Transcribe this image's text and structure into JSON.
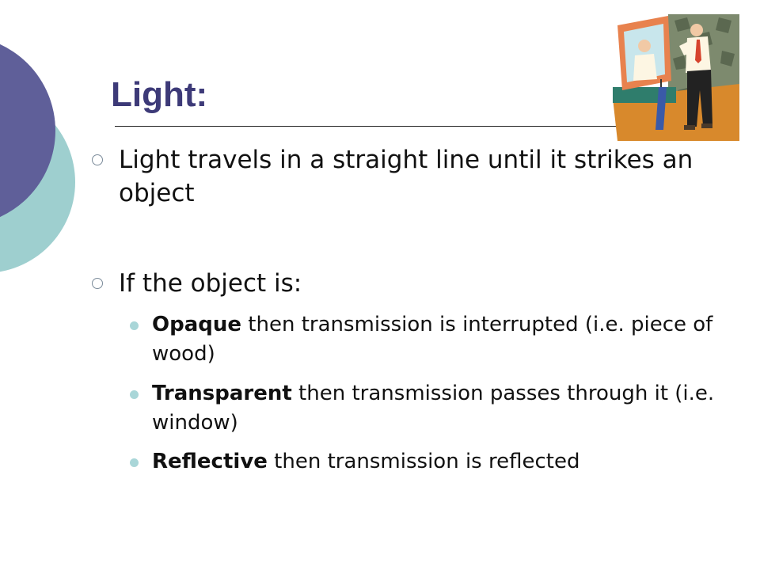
{
  "slide": {
    "title": "Light:",
    "bullets": [
      {
        "text": "Light travels in a straight line until it strikes an object"
      },
      {
        "text": "If the object is:"
      }
    ],
    "sub_bullets": [
      {
        "term": "Opaque",
        "text": " then transmission is interrupted (i.e. piece of wood)"
      },
      {
        "term": "Transparent",
        "text": " then transmission passes through it  (i.e. window)"
      },
      {
        "term": "Reflective",
        "text": " then transmission is reflected"
      }
    ]
  },
  "colors": {
    "title": "#3d3a78",
    "circle_dark": "#5f5f99",
    "circle_light": "#9ecfcf",
    "sub_bullet": "#a9d6d8"
  },
  "icons": {
    "bullet_level1": "hollow-circle",
    "bullet_level2": "filled-circle",
    "clipart": "man-looking-in-mirror-clipart"
  }
}
